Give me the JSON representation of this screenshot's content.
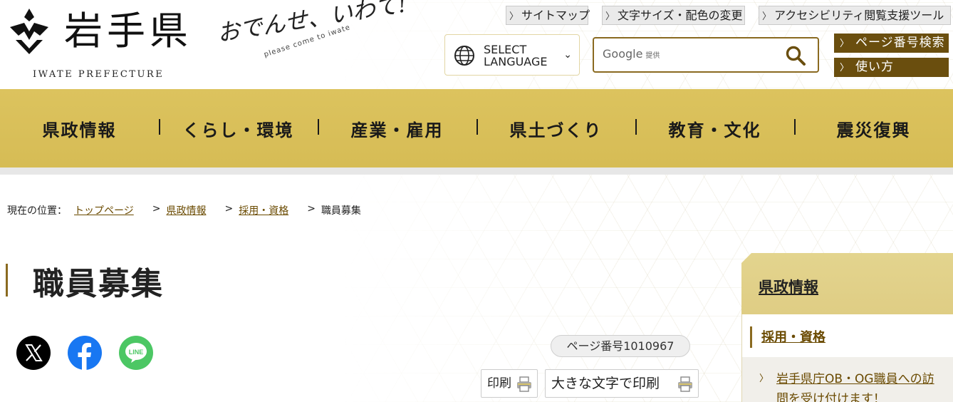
{
  "header": {
    "logo_text": "岩手県",
    "logo_en": "IWATE PREFECTURE",
    "tagline": "おでんせ、いわて!",
    "tagline_sub": "please come to iwate"
  },
  "utility_links": [
    {
      "label": "サイトマップ"
    },
    {
      "label": "文字サイズ・配色の変更"
    },
    {
      "label": "アクセシビリティ閲覧支援ツール"
    }
  ],
  "language": {
    "line1": "SELECT",
    "line2": "LANGUAGE"
  },
  "search": {
    "brand": "Google",
    "brand_sub": "提供",
    "value": ""
  },
  "right_buttons": [
    {
      "label": "ページ番号検索"
    },
    {
      "label": "使い方"
    }
  ],
  "nav": [
    {
      "label": "県政情報"
    },
    {
      "label": "くらし・環境"
    },
    {
      "label": "産業・雇用"
    },
    {
      "label": "県土づくり"
    },
    {
      "label": "教育・文化"
    },
    {
      "label": "震災復興"
    }
  ],
  "breadcrumb": {
    "prefix": "現在の位置：",
    "items": [
      {
        "label": "トップページ"
      },
      {
        "label": "県政情報"
      },
      {
        "label": "採用・資格"
      },
      {
        "label": "職員募集"
      }
    ],
    "separator": ">"
  },
  "page": {
    "title": "職員募集",
    "page_number": "ページ番号1010967",
    "print_label": "印刷",
    "print_large_label": "大きな文字で印刷"
  },
  "sidebar": {
    "header": "県政情報",
    "sub": "採用・資格",
    "items": [
      {
        "label": "岩手県庁OB・OG職員への訪問を受け付けます！"
      }
    ]
  },
  "colors": {
    "nav_bg": "#d6bc55",
    "brand_brown": "#6a4e0e",
    "link": "#6a4a00"
  }
}
